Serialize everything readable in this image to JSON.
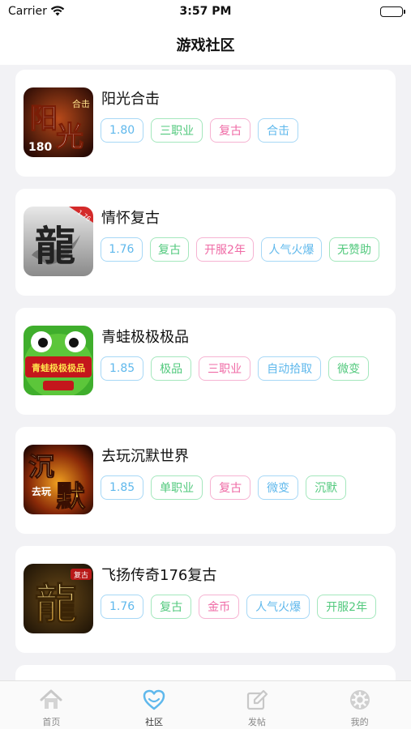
{
  "status": {
    "carrier": "Carrier",
    "time": "3:57 PM"
  },
  "nav": {
    "title": "游戏社区"
  },
  "games": [
    {
      "name": "阳光合击",
      "thumb": "sunshine-game-icon",
      "thumb_text": [
        "阳",
        "光"
      ],
      "thumb_badge": "合击",
      "thumb_sub": "180",
      "tags": [
        {
          "text": "1.80",
          "color": "blue"
        },
        {
          "text": "三职业",
          "color": "green"
        },
        {
          "text": "复古",
          "color": "pink"
        },
        {
          "text": "合击",
          "color": "blue"
        }
      ]
    },
    {
      "name": "情怀复古",
      "thumb": "dragon-game-icon",
      "thumb_text": [
        "龍"
      ],
      "thumb_badge": "1.76",
      "tags": [
        {
          "text": "1.76",
          "color": "blue"
        },
        {
          "text": "复古",
          "color": "green"
        },
        {
          "text": "开服2年",
          "color": "pink"
        },
        {
          "text": "人气火爆",
          "color": "blue"
        },
        {
          "text": "无赞助",
          "color": "green"
        }
      ]
    },
    {
      "name": "青蛙极极极品",
      "thumb": "frog-game-icon",
      "thumb_text": [
        "青蛙极极极品"
      ],
      "thumb_badge": "",
      "tags": [
        {
          "text": "1.85",
          "color": "blue"
        },
        {
          "text": "极品",
          "color": "green"
        },
        {
          "text": "三职业",
          "color": "pink"
        },
        {
          "text": "自动拾取",
          "color": "blue"
        },
        {
          "text": "微变",
          "color": "green"
        }
      ]
    },
    {
      "name": "去玩沉默世界",
      "thumb": "silence-game-icon",
      "thumb_text": [
        "沉",
        "默"
      ],
      "thumb_badge": "去玩",
      "tags": [
        {
          "text": "1.85",
          "color": "blue"
        },
        {
          "text": "单职业",
          "color": "green"
        },
        {
          "text": "复古",
          "color": "pink"
        },
        {
          "text": "微变",
          "color": "blue"
        },
        {
          "text": "沉默",
          "color": "green"
        }
      ]
    },
    {
      "name": "飞扬传奇176复古",
      "thumb": "golden-dragon-game-icon",
      "thumb_text": [
        "龍"
      ],
      "thumb_badge": "复古",
      "tags": [
        {
          "text": "1.76",
          "color": "blue"
        },
        {
          "text": "复古",
          "color": "green"
        },
        {
          "text": "金币",
          "color": "pink"
        },
        {
          "text": "人气火爆",
          "color": "blue"
        },
        {
          "text": "开服2年",
          "color": "green"
        }
      ]
    }
  ],
  "tabs": [
    {
      "label": "首页",
      "icon": "home-icon",
      "active": false
    },
    {
      "label": "社区",
      "icon": "community-heart-icon",
      "active": true
    },
    {
      "label": "发帖",
      "icon": "post-edit-icon",
      "active": false
    },
    {
      "label": "我的",
      "icon": "profile-gear-icon",
      "active": false
    }
  ],
  "colors": {
    "blue": "#5fb8ec",
    "green": "#52c97d",
    "pink": "#ef6aa5",
    "active_tab": "#5fb8ec"
  }
}
